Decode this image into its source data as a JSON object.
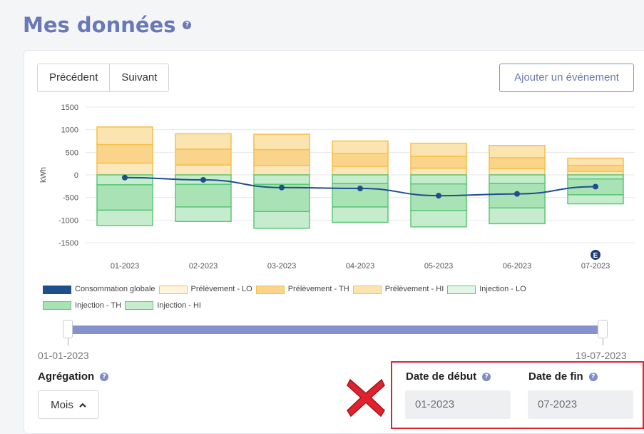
{
  "header": {
    "title": "Mes données"
  },
  "toolbar": {
    "prev_label": "Précédent",
    "next_label": "Suivant",
    "add_event_label": "Ajouter un événement"
  },
  "chart_data": {
    "type": "bar",
    "ylabel": "kWh",
    "ylim": [
      -1500,
      1500
    ],
    "yticks": [
      "1500",
      "1000",
      "500",
      "0",
      "-500",
      "-1000",
      "-1500"
    ],
    "categories": [
      "01-2023",
      "02-2023",
      "03-2023",
      "04-2023",
      "05-2023",
      "06-2023",
      "07-2023"
    ],
    "series": [
      {
        "name": "Prélèvement - LO",
        "color": "#fbe7bb",
        "stroke": "#f5c047",
        "values": [
          260,
          220,
          210,
          190,
          150,
          140,
          80
        ]
      },
      {
        "name": "Prélèvement - TH",
        "color": "#f9d48a",
        "stroke": "#f5c047",
        "values": [
          410,
          350,
          350,
          280,
          260,
          240,
          130
        ]
      },
      {
        "name": "Prélèvement - HI",
        "color": "#fce4b0",
        "stroke": "#f5c047",
        "values": [
          390,
          340,
          340,
          280,
          290,
          270,
          160
        ]
      },
      {
        "name": "Injection - LO",
        "color": "#c5eccd",
        "stroke": "#5cc876",
        "values": [
          -220,
          -210,
          -210,
          -190,
          -200,
          -190,
          -90
        ]
      },
      {
        "name": "Injection - TH",
        "color": "#a9e2b4",
        "stroke": "#5cc876",
        "values": [
          -560,
          -500,
          -600,
          -520,
          -590,
          -540,
          -350
        ]
      },
      {
        "name": "Injection - HI",
        "color": "#c5eccd",
        "stroke": "#5cc876",
        "values": [
          -340,
          -320,
          -370,
          -340,
          -360,
          -350,
          -200
        ]
      }
    ],
    "line": {
      "name": "Consommation globale",
      "color": "#1f4e8c",
      "values": [
        -60,
        -110,
        -280,
        -300,
        -460,
        -420,
        -260
      ]
    },
    "event_marker": {
      "label": "E",
      "category": "07-2023"
    }
  },
  "legend": {
    "items": [
      {
        "label": "Consommation globale",
        "fill": "#1f4e8c",
        "stroke": "#1f4e8c"
      },
      {
        "label": "Prélèvement - LO",
        "fill": "#fef3dc",
        "stroke": "#f5c047"
      },
      {
        "label": "Prélèvement - TH",
        "fill": "#f9d48a",
        "stroke": "#f5c047"
      },
      {
        "label": "Prélèvement - HI",
        "fill": "#fce4b0",
        "stroke": "#f5c047"
      },
      {
        "label": "Injection - LO",
        "fill": "#e3f6e7",
        "stroke": "#5cc876"
      },
      {
        "label": "Injection - TH",
        "fill": "#a9e2b4",
        "stroke": "#5cc876"
      },
      {
        "label": "Injection - HI",
        "fill": "#c5eccd",
        "stroke": "#5cc876"
      }
    ]
  },
  "range": {
    "start_label": "01-01-2023",
    "end_label": "19-07-2023"
  },
  "aggregation": {
    "label": "Agrégation",
    "value": "Mois"
  },
  "dates": {
    "start_label": "Date de début",
    "start_value": "01-2023",
    "end_label": "Date de fin",
    "end_value": "07-2023"
  },
  "colors": {
    "accent": "#6a78b6",
    "highlight": "#e0222e"
  }
}
